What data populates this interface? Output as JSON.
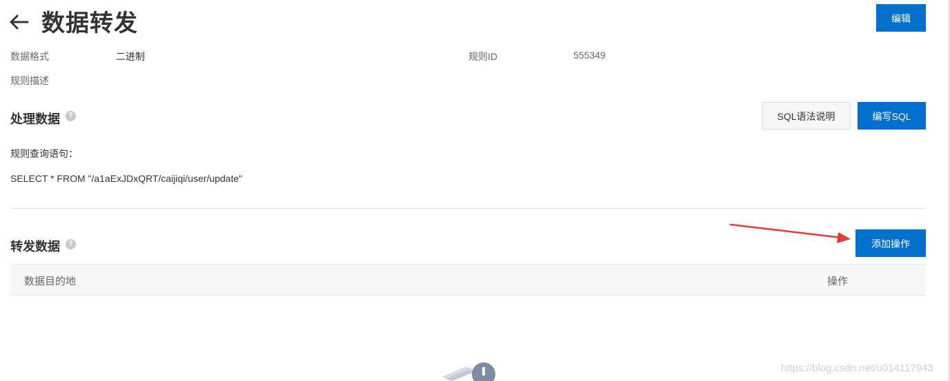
{
  "header": {
    "title": "数据转发",
    "edit_label": "编辑"
  },
  "info": {
    "format_label": "数据格式",
    "format_value": "二进制",
    "rule_id_label": "规则ID",
    "rule_id_value": "555349",
    "description_label": "规则描述"
  },
  "process": {
    "title": "处理数据",
    "sql_help_label": "SQL语法说明",
    "write_sql_label": "编写SQL",
    "query_label": "规则查询语句：",
    "query_text": "SELECT * FROM \"/a1aExJDxQRT/caijiqi/user/update\""
  },
  "forward": {
    "title": "转发数据",
    "add_label": "添加操作",
    "columns": [
      "数据目的地",
      "操作"
    ]
  },
  "watermark": "https://blog.csdn.net/u014117943",
  "colors": {
    "primary": "#0070cc",
    "annotation_arrow": "#e53935"
  },
  "icons": {
    "back": "arrow-left-icon",
    "help": "question-circle-icon",
    "empty": "empty-state-icon"
  }
}
